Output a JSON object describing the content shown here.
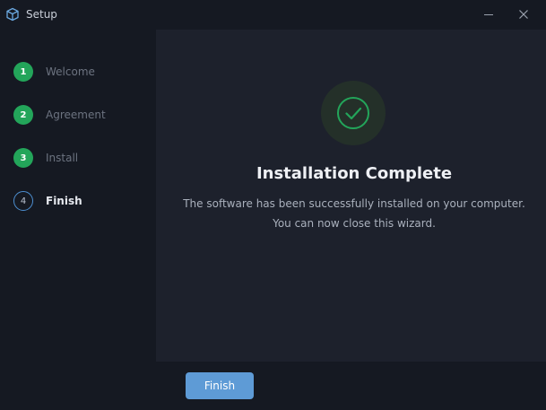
{
  "window": {
    "title": "Setup",
    "icon": "cube-icon"
  },
  "sidebar": {
    "steps": [
      {
        "number": "1",
        "label": "Welcome",
        "state": "completed"
      },
      {
        "number": "2",
        "label": "Agreement",
        "state": "completed"
      },
      {
        "number": "3",
        "label": "Install",
        "state": "completed"
      },
      {
        "number": "4",
        "label": "Finish",
        "state": "current"
      }
    ]
  },
  "main": {
    "icon": "check-circle-icon",
    "heading": "Installation Complete",
    "message_line1": "The software has been successfully installed on your computer.",
    "message_line2": "You can now close this wizard."
  },
  "footer": {
    "finish_label": "Finish"
  },
  "colors": {
    "background": "#151922",
    "panel": "#1d212c",
    "success": "#23a55a",
    "accent": "#5e9bd6",
    "current_step_ring": "#4d8fd1"
  }
}
